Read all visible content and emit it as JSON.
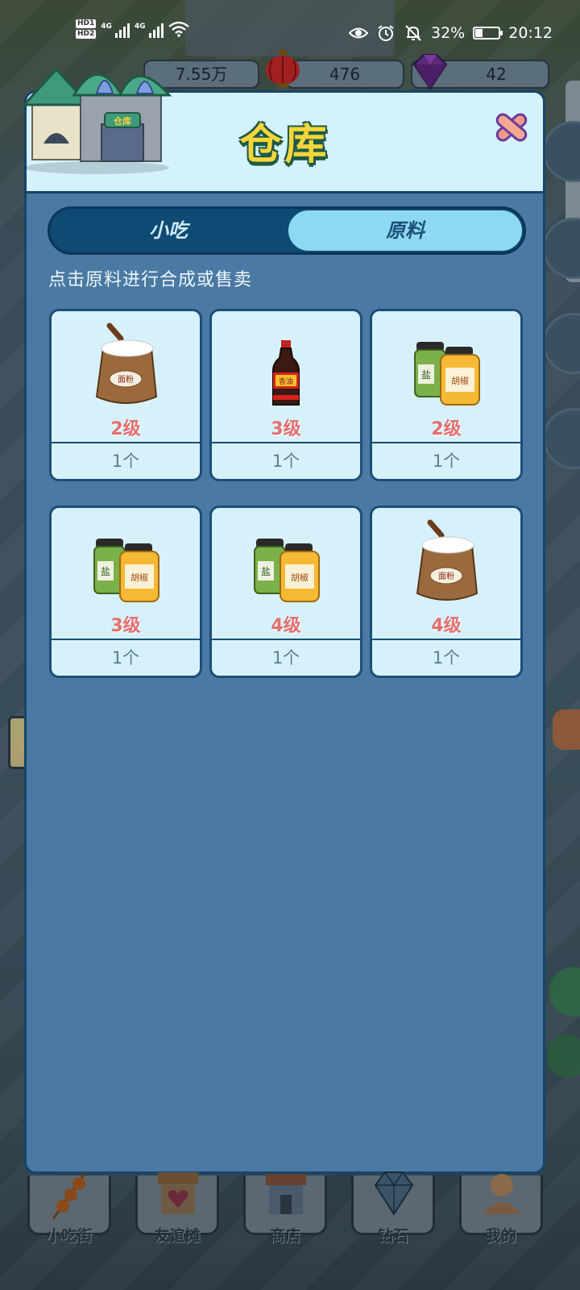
{
  "status_bar": {
    "hd1": "HD1",
    "hd2": "HD2",
    "net1": "4G",
    "net2": "4G",
    "battery_percent": "32%",
    "battery_level": 0.32,
    "time": "20:12",
    "icons": [
      "eye-icon",
      "alarm-icon",
      "bell-off-icon",
      "wifi-icon",
      "battery-icon"
    ]
  },
  "currencies": {
    "coins": "7.55万",
    "lanterns": "476",
    "gems": "42"
  },
  "modal": {
    "title": "仓库",
    "tabs": [
      {
        "label": "小吃",
        "active": false
      },
      {
        "label": "原料",
        "active": true
      }
    ],
    "hint": "点击原料进行合成或售卖",
    "items": [
      {
        "icon": "flour-sack-icon",
        "art_label": "面粉",
        "level": "2级",
        "count": "1个"
      },
      {
        "icon": "soy-sauce-bottle-icon",
        "art_label": "香油",
        "level": "3级",
        "count": "1个"
      },
      {
        "icon": "salt-pepper-jars-icon",
        "art_label_a": "盐",
        "art_label_b": "胡椒",
        "level": "2级",
        "count": "1个"
      },
      {
        "icon": "salt-pepper-jars-icon",
        "art_label_a": "盐",
        "art_label_b": "胡椒",
        "level": "3级",
        "count": "1个"
      },
      {
        "icon": "salt-pepper-jars-icon",
        "art_label_a": "盐",
        "art_label_b": "胡椒",
        "level": "4级",
        "count": "1个"
      },
      {
        "icon": "flour-sack-icon",
        "art_label": "面粉",
        "level": "4级",
        "count": "1个"
      }
    ],
    "warehouse_sign": "仓库"
  },
  "bottom_nav": [
    {
      "label": "小吃街",
      "icon": "skewer-icon"
    },
    {
      "label": "友谊摊",
      "icon": "heart-stall-icon"
    },
    {
      "label": "商店",
      "icon": "shop-icon"
    },
    {
      "label": "钻石",
      "icon": "diamond-icon"
    },
    {
      "label": "我的",
      "icon": "profile-icon"
    }
  ],
  "colors": {
    "modal_body": "#4a7aa3",
    "modal_header": "#d4f2fb",
    "card_bg": "#d7f1fb",
    "level_text": "#e46e6e",
    "active_tab": "#8dd9f4",
    "title_yellow": "#f6d53a"
  }
}
